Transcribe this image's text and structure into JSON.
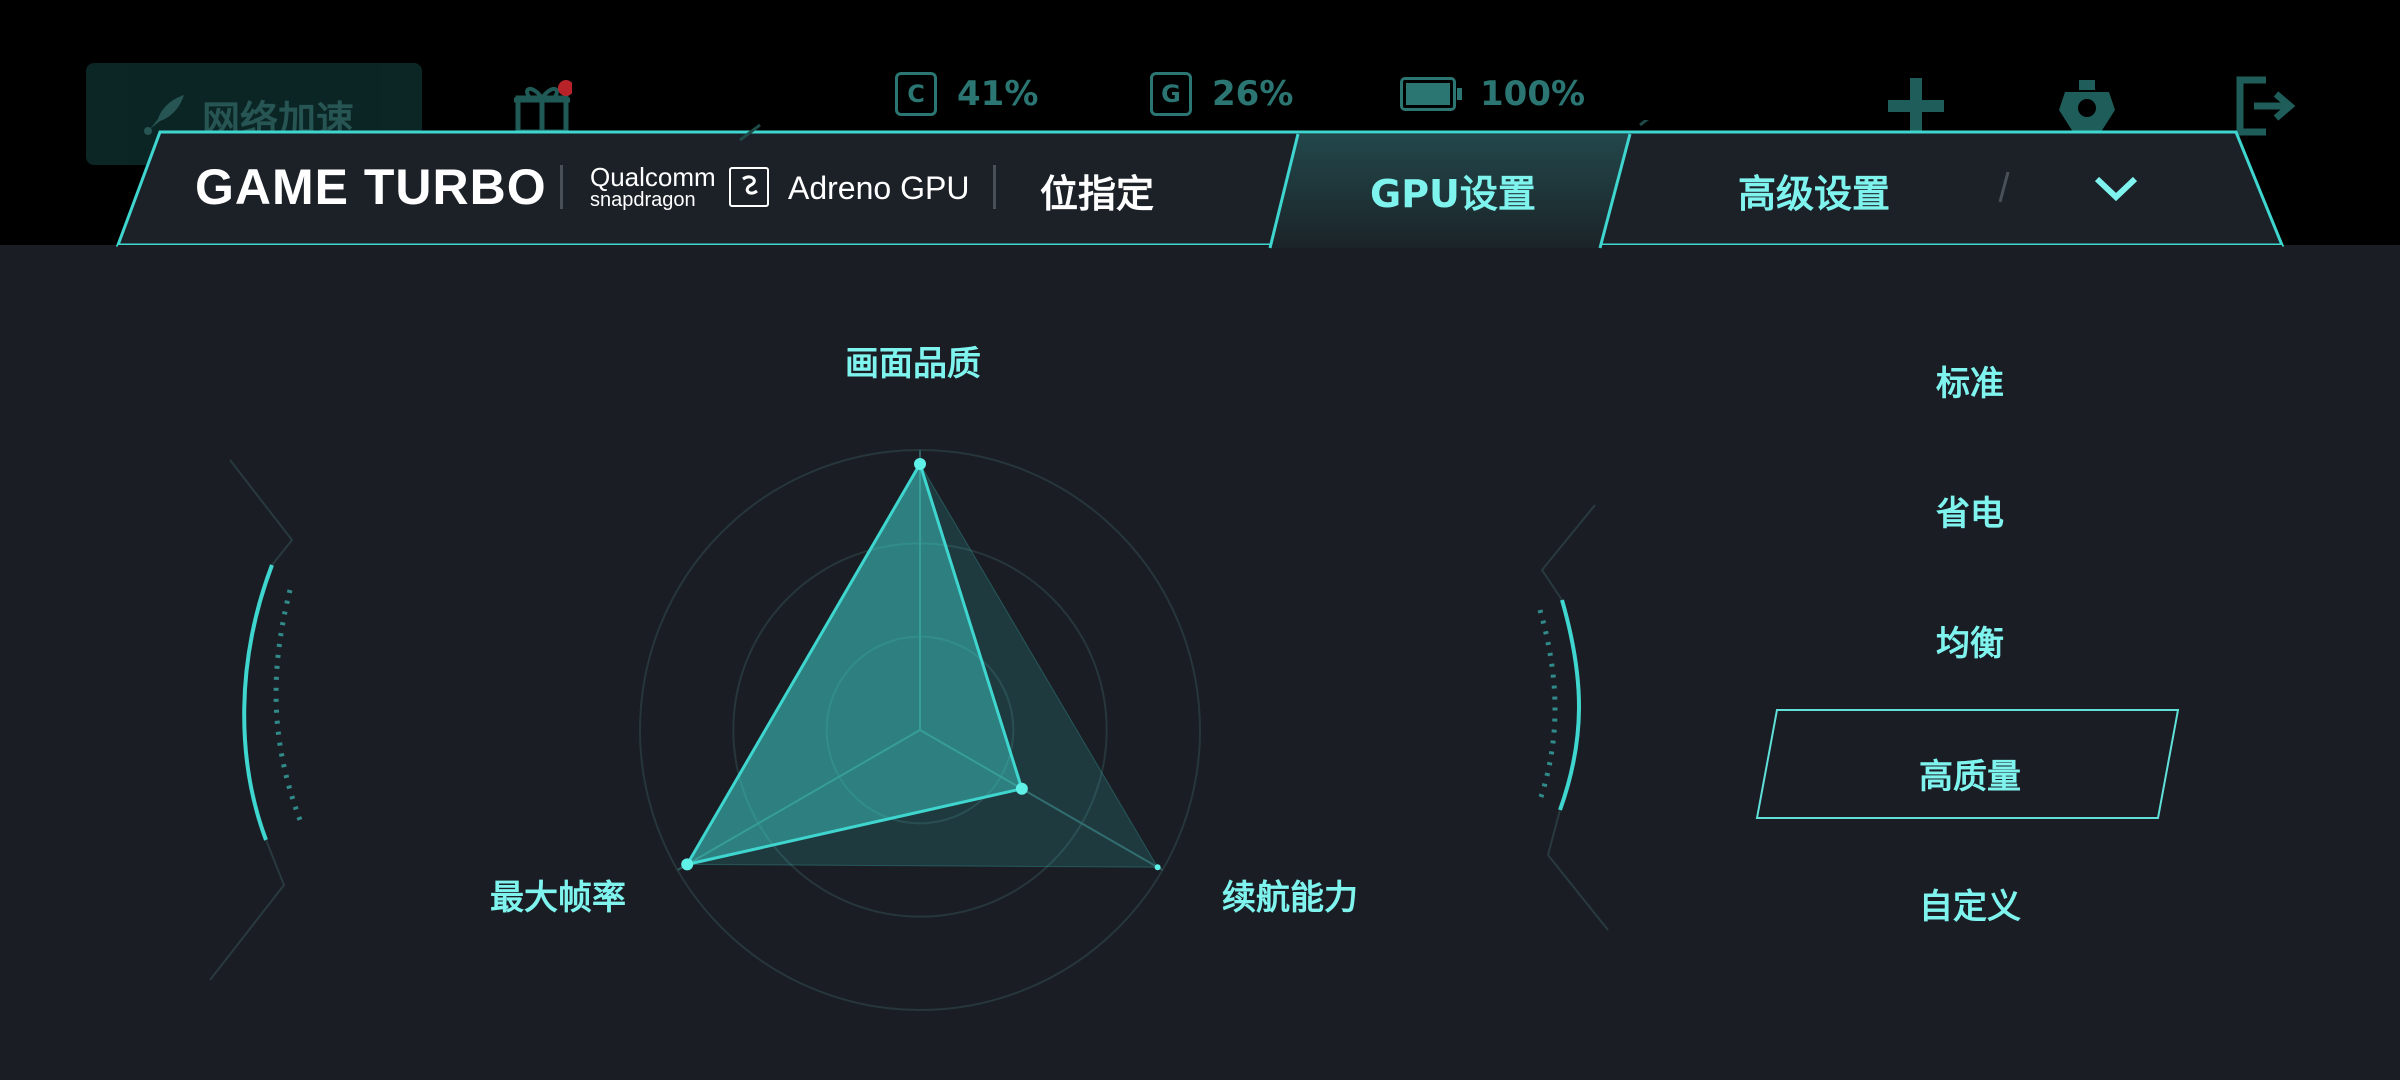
{
  "colors": {
    "accent": "#7ff3ee",
    "background": "#1a1d24",
    "panel": "#1c2128",
    "dim": "#2b7672"
  },
  "topbar": {
    "network_label": "网络加速",
    "cpu": {
      "icon": "C",
      "value": "41%"
    },
    "gpu": {
      "icon": "G",
      "value": "26%"
    },
    "battery": {
      "value": "100%"
    },
    "icons": [
      "rocket-icon",
      "gift-icon",
      "plus-icon",
      "robot-icon",
      "exit-icon"
    ]
  },
  "header": {
    "brand": "GAME TURBO",
    "qualcomm_line1": "Qualcomm",
    "qualcomm_line2": "snapdragon",
    "gpu_name": "Adreno GPU",
    "tab_partial": "位指定",
    "tab_gpu": "GPU设置",
    "tab_advanced": "高级设置"
  },
  "chart_data": {
    "type": "radar",
    "axes": [
      "画面品质",
      "续航能力",
      "最大帧率"
    ],
    "max": 1,
    "rings": 3,
    "series": [
      {
        "values": [
          0.95,
          0.42,
          0.96
        ]
      },
      {
        "values": [
          0.95,
          0.98,
          0.96
        ]
      }
    ]
  },
  "modes": {
    "items": [
      "标准",
      "省电",
      "均衡",
      "高质量",
      "自定义"
    ],
    "selected_index": 3
  }
}
